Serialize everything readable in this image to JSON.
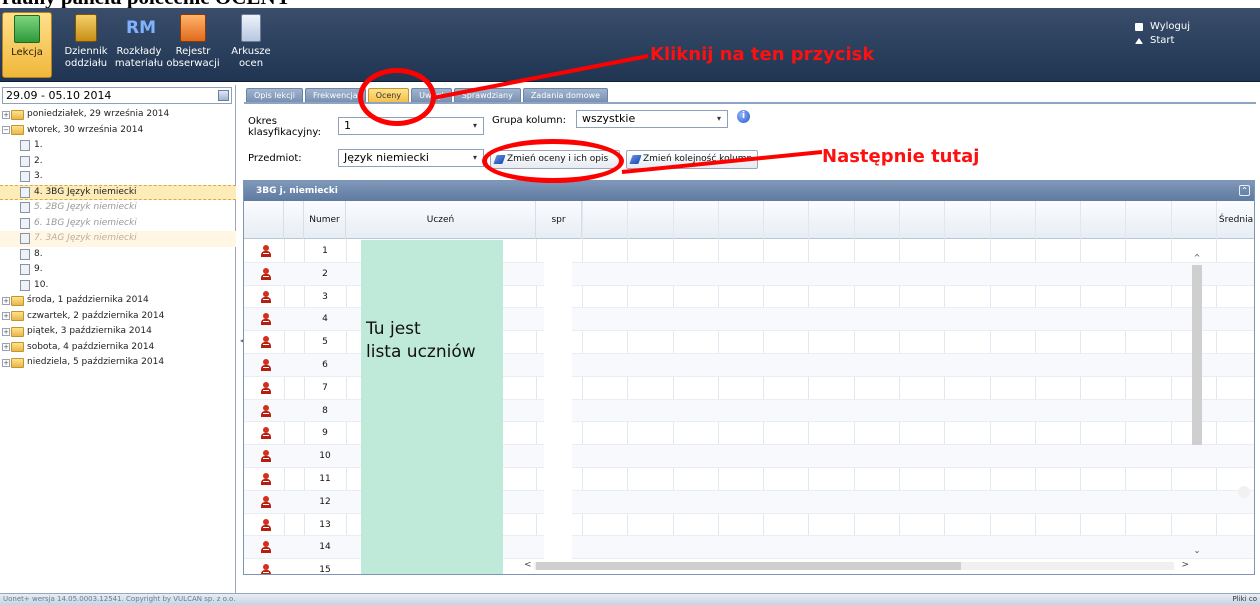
{
  "caption": "rauny panelu polecenie OCENY",
  "toolbar": {
    "buttons": [
      {
        "label_1": "Lekcja",
        "label_2": "",
        "icon": "lesson-icon"
      },
      {
        "label_1": "Dziennik",
        "label_2": "oddziału",
        "icon": "journal-icon"
      },
      {
        "label_1": "Rozkłady",
        "label_2": "materiału",
        "icon": "rm-icon",
        "icon_text": "RM"
      },
      {
        "label_1": "Rejestr",
        "label_2": "obserwacji",
        "icon": "register-icon"
      },
      {
        "label_1": "Arkusze",
        "label_2": "ocen",
        "icon": "sheets-icon"
      }
    ],
    "logout": "Wyloguj",
    "start": "Start"
  },
  "left": {
    "date_range": "29.09 - 05.10 2014",
    "tree": [
      {
        "label": "poniedziałek, 29 września 2014"
      },
      {
        "label": "wtorek, 30 września 2014"
      },
      {
        "label": "1."
      },
      {
        "label": "2."
      },
      {
        "label": "3."
      },
      {
        "label": "4. 3BG Język niemiecki"
      },
      {
        "label": "5. 2BG Język niemiecki"
      },
      {
        "label": "6. 1BG Język niemiecki"
      },
      {
        "label": "7. 3AG Język niemiecki"
      },
      {
        "label": "8."
      },
      {
        "label": "9."
      },
      {
        "label": "10."
      },
      {
        "label": "środa, 1 października 2014"
      },
      {
        "label": "czwartek, 2 października 2014"
      },
      {
        "label": "piątek, 3 października 2014"
      },
      {
        "label": "sobota, 4 października 2014"
      },
      {
        "label": "niedziela, 5 października 2014"
      }
    ]
  },
  "tabs": [
    {
      "label": "Opis lekcji"
    },
    {
      "label": "Frekwencja"
    },
    {
      "label": "Oceny"
    },
    {
      "label": "Uwagi"
    },
    {
      "label": "Sprawdziany"
    },
    {
      "label": "Zadania domowe"
    }
  ],
  "form": {
    "okres_label_1": "Okres",
    "okres_label_2": "klasyfikacyjny:",
    "okres_value": "1",
    "grupa_label": "Grupa kolumn:",
    "grupa_value": "wszystkie",
    "info": "i",
    "przedmiot_label": "Przedmiot:",
    "przedmiot_value": "Język niemiecki",
    "btn_change_grades": "Zmień oceny i ich opis",
    "btn_change_order": "Zmień kolejność kolumn"
  },
  "grid": {
    "title": "3BG j. niemiecki",
    "col_numer": "Numer",
    "col_uczen": "Uczeń",
    "col_spr": "spr",
    "col_srednia": "Średnia",
    "rows": [
      "1",
      "2",
      "3",
      "4",
      "5",
      "6",
      "7",
      "8",
      "9",
      "10",
      "11",
      "12",
      "13",
      "14",
      "15"
    ],
    "overlay_line1": "Tu jest",
    "overlay_line2": "lista uczniów"
  },
  "status": {
    "left": "Uonet+ wersja 14.05.0003.12541. Copyright by VULCAN sp. z o.o.",
    "right": "Pliki co"
  },
  "annotations": {
    "click_here": "Kliknij na ten przycisk",
    "next_here": "Następnie tutaj",
    "color": "#ff0000"
  }
}
